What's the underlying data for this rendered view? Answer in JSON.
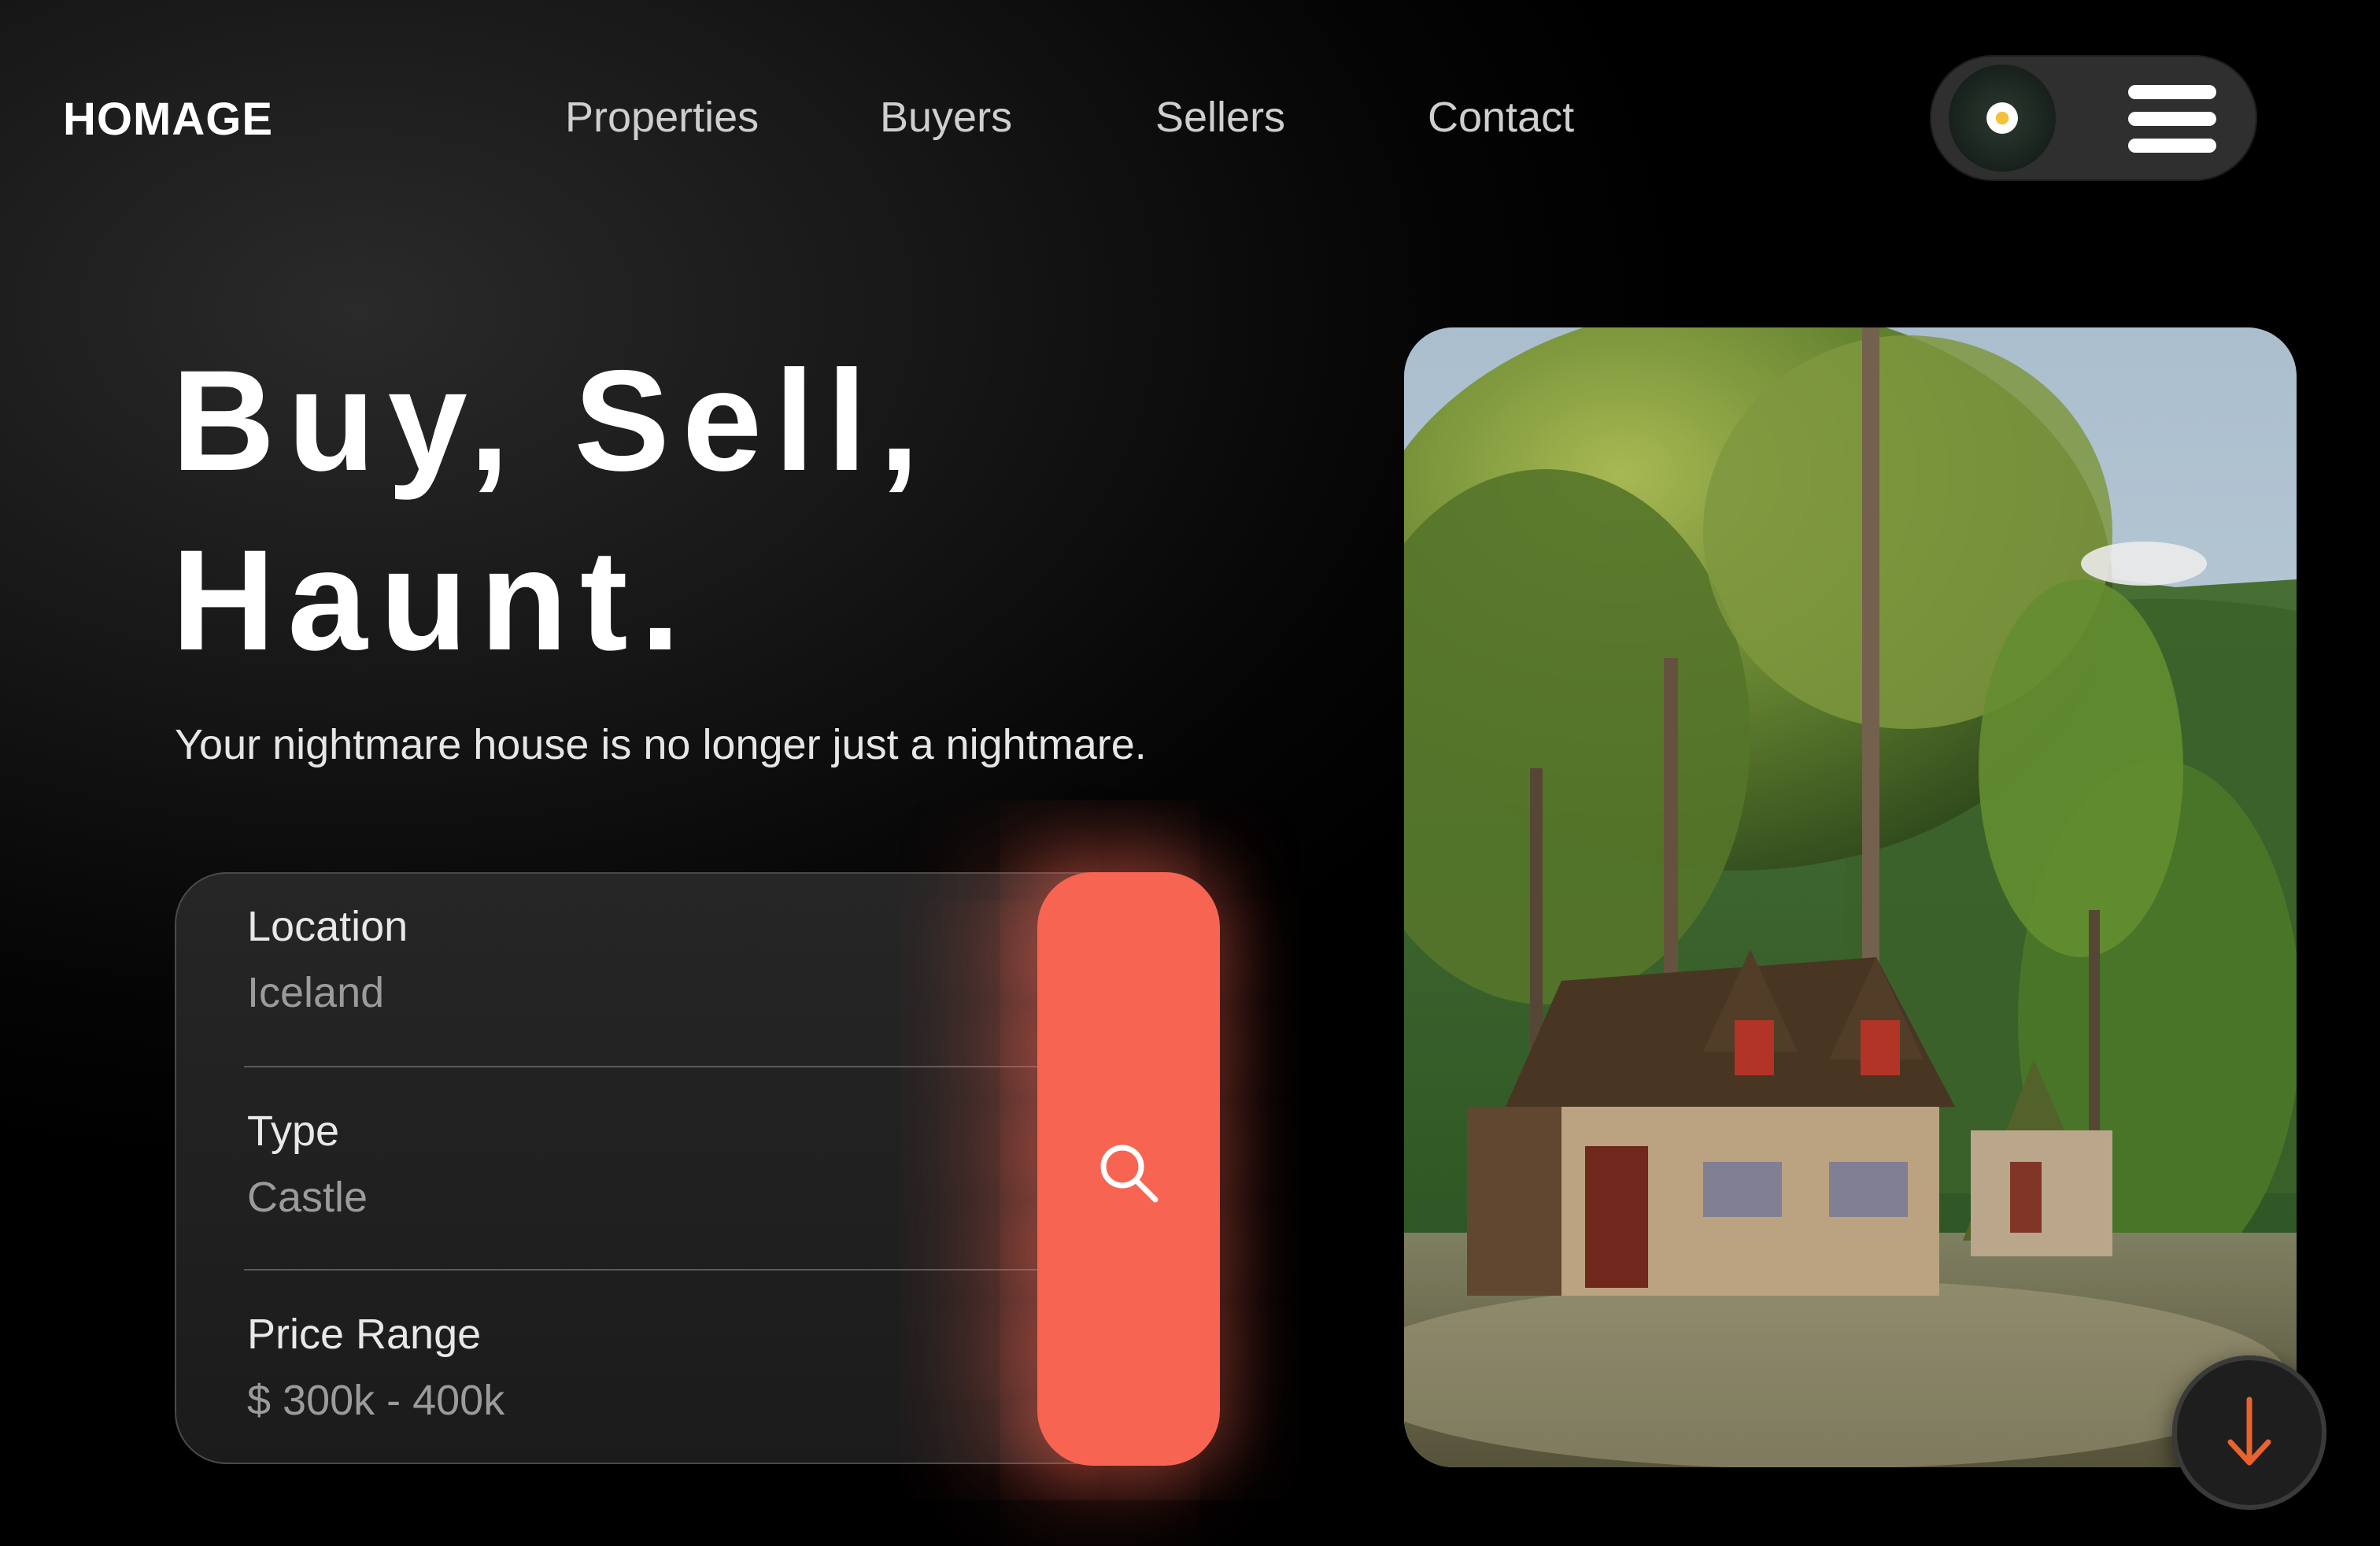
{
  "brand": {
    "logo": "HOMAGE"
  },
  "nav": {
    "items": [
      {
        "label": "Properties"
      },
      {
        "label": "Buyers"
      },
      {
        "label": "Sellers"
      },
      {
        "label": "Contact"
      }
    ]
  },
  "header_actions": {
    "avatar_icon": "daisy-avatar",
    "menu_icon": "hamburger-menu-icon"
  },
  "hero": {
    "headline_line1": "Buy, Sell,",
    "headline_line2": "Haunt.",
    "subtitle": "Your nightmare house is no longer just a nightmare."
  },
  "search": {
    "fields": [
      {
        "label": "Location",
        "value": "Iceland"
      },
      {
        "label": "Type",
        "value": "Castle"
      },
      {
        "label": "Price Range",
        "value": "$ 300k - 400k"
      }
    ],
    "button_icon": "search-icon",
    "button_color": "#f76552"
  },
  "hero_image": {
    "subject": "cottage-in-forest-photo"
  },
  "scroll_button": {
    "icon": "arrow-down-icon",
    "icon_color": "#e8632e"
  },
  "colors": {
    "background": "#000000",
    "accent": "#f76552",
    "text": "#ffffff"
  }
}
